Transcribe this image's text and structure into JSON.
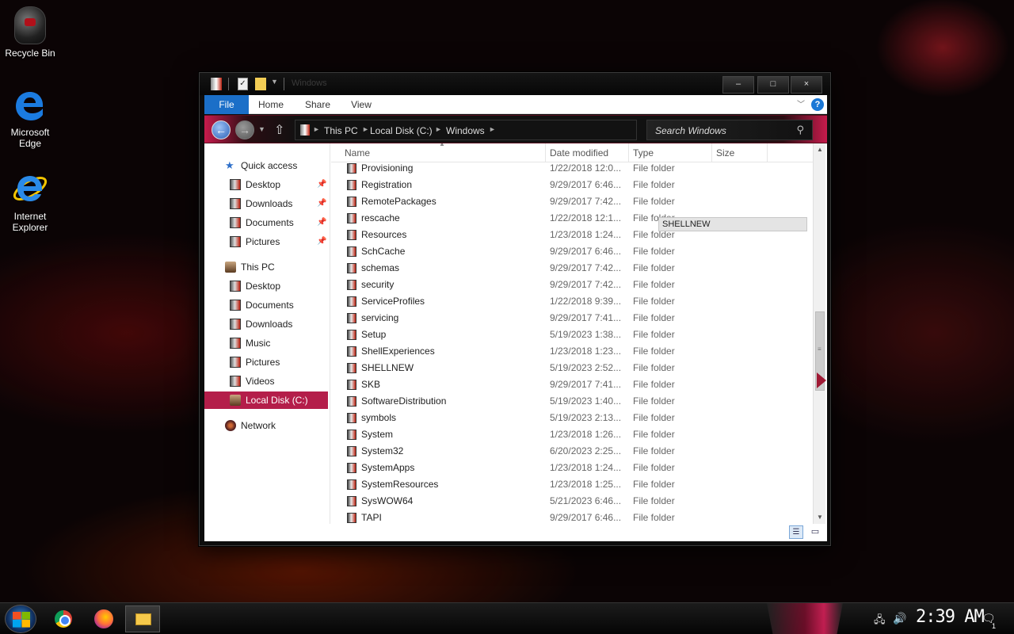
{
  "desktop": {
    "icons": [
      {
        "label": "Recycle Bin"
      },
      {
        "label": "Microsoft Edge"
      },
      {
        "label": "Internet Explorer"
      }
    ]
  },
  "window": {
    "title": "Windows",
    "caption": {
      "minimize": "–",
      "maximize": "□",
      "close": "×"
    },
    "ribbon": {
      "file": "File",
      "home": "Home",
      "share": "Share",
      "view": "View",
      "help": "?"
    },
    "address": {
      "this_pc": "This PC",
      "drive": "Local Disk (C:)",
      "folder": "Windows"
    },
    "search": {
      "placeholder": "Search Windows"
    }
  },
  "navpane": {
    "quick_access": "Quick access",
    "quick_items": [
      {
        "label": "Desktop"
      },
      {
        "label": "Downloads"
      },
      {
        "label": "Documents"
      },
      {
        "label": "Pictures"
      }
    ],
    "this_pc": "This PC",
    "pc_items": [
      {
        "label": "Desktop"
      },
      {
        "label": "Documents"
      },
      {
        "label": "Downloads"
      },
      {
        "label": "Music"
      },
      {
        "label": "Pictures"
      },
      {
        "label": "Videos"
      },
      {
        "label": "Local Disk (C:)"
      }
    ],
    "network": "Network"
  },
  "columns": {
    "name": "Name",
    "date": "Date modified",
    "type": "Type",
    "size": "Size"
  },
  "files": [
    {
      "name": "Provisioning",
      "date": "1/22/2018 12:0...",
      "type": "File folder"
    },
    {
      "name": "Registration",
      "date": "9/29/2017 6:46...",
      "type": "File folder"
    },
    {
      "name": "RemotePackages",
      "date": "9/29/2017 7:42...",
      "type": "File folder"
    },
    {
      "name": "rescache",
      "date": "1/22/2018 12:1...",
      "type": "File folder"
    },
    {
      "name": "Resources",
      "date": "1/23/2018 1:24...",
      "type": "File folder"
    },
    {
      "name": "SchCache",
      "date": "9/29/2017 6:46...",
      "type": "File folder"
    },
    {
      "name": "schemas",
      "date": "9/29/2017 7:42...",
      "type": "File folder"
    },
    {
      "name": "security",
      "date": "9/29/2017 7:42...",
      "type": "File folder"
    },
    {
      "name": "ServiceProfiles",
      "date": "1/22/2018 9:39...",
      "type": "File folder"
    },
    {
      "name": "servicing",
      "date": "9/29/2017 7:41...",
      "type": "File folder"
    },
    {
      "name": "Setup",
      "date": "5/19/2023 1:38...",
      "type": "File folder"
    },
    {
      "name": "ShellExperiences",
      "date": "1/23/2018 1:23...",
      "type": "File folder"
    },
    {
      "name": "SHELLNEW",
      "date": "5/19/2023 2:52...",
      "type": "File folder"
    },
    {
      "name": "SKB",
      "date": "9/29/2017 7:41...",
      "type": "File folder"
    },
    {
      "name": "SoftwareDistribution",
      "date": "5/19/2023 1:40...",
      "type": "File folder"
    },
    {
      "name": "symbols",
      "date": "5/19/2023 2:13...",
      "type": "File folder"
    },
    {
      "name": "System",
      "date": "1/23/2018 1:26...",
      "type": "File folder"
    },
    {
      "name": "System32",
      "date": "6/20/2023 2:25...",
      "type": "File folder"
    },
    {
      "name": "SystemApps",
      "date": "1/23/2018 1:24...",
      "type": "File folder"
    },
    {
      "name": "SystemResources",
      "date": "1/23/2018 1:25...",
      "type": "File folder"
    },
    {
      "name": "SysWOW64",
      "date": "5/21/2023 6:46...",
      "type": "File folder"
    },
    {
      "name": "TAPI",
      "date": "9/29/2017 6:46...",
      "type": "File folder"
    }
  ],
  "tooltip": "SHELLNEW",
  "taskbar": {
    "clock": "2:39 AM",
    "notifications": "1"
  },
  "colors": {
    "accent": "#b41e4a",
    "file_tab": "#1b6fc8"
  }
}
